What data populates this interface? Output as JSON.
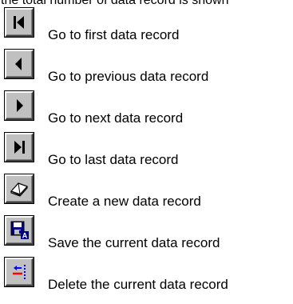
{
  "intro_text": "the total number of data record is shown",
  "buttons": [
    {
      "icon": "first-record-icon",
      "label": "Go to first data record"
    },
    {
      "icon": "previous-record-icon",
      "label": "Go to previous data record"
    },
    {
      "icon": "next-record-icon",
      "label": "Go to next data record"
    },
    {
      "icon": "last-record-icon",
      "label": "Go to last data record"
    },
    {
      "icon": "new-record-icon",
      "label": "Create a new data record"
    },
    {
      "icon": "save-record-icon",
      "label": "Save the current data record"
    },
    {
      "icon": "delete-record-icon",
      "label": "Delete the current data record"
    }
  ],
  "colors": {
    "button_face": "#c0c0c0",
    "icon_dark": "#000000",
    "save_accent": "#000080",
    "delete_red": "#ff0000",
    "delete_blue": "#0000ff"
  }
}
